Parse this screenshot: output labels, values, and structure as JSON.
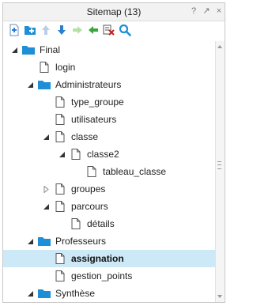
{
  "window": {
    "title": "Sitemap (13)",
    "controls": [
      "?",
      "↗",
      "×"
    ]
  },
  "toolbar": [
    {
      "name": "add-page-icon",
      "color": "#2a7fd0"
    },
    {
      "name": "add-folder-icon",
      "color": "#1e8fd6"
    },
    {
      "name": "move-up-icon",
      "color": "#b9cfe6"
    },
    {
      "name": "move-down-icon",
      "color": "#2a7fd0"
    },
    {
      "name": "indent-icon",
      "color": "#b6e0a6"
    },
    {
      "name": "outdent-icon",
      "color": "#3aa63a"
    },
    {
      "name": "delete-icon",
      "color": "#c02020"
    },
    {
      "name": "search-icon",
      "color": "#1e8fd6"
    }
  ],
  "tree": [
    {
      "label": "Final",
      "level": 0,
      "type": "folder",
      "expander": "expanded"
    },
    {
      "label": "login",
      "level": 1,
      "type": "page",
      "expander": "none"
    },
    {
      "label": "Administrateurs",
      "level": 1,
      "type": "folder",
      "expander": "expanded"
    },
    {
      "label": "type_groupe",
      "level": 2,
      "type": "page",
      "expander": "none"
    },
    {
      "label": "utilisateurs",
      "level": 2,
      "type": "page",
      "expander": "none"
    },
    {
      "label": "classe",
      "level": 2,
      "type": "page",
      "expander": "expanded"
    },
    {
      "label": "classe2",
      "level": 3,
      "type": "page",
      "expander": "expanded"
    },
    {
      "label": "tableau_classe",
      "level": 4,
      "type": "page",
      "expander": "none"
    },
    {
      "label": "groupes",
      "level": 2,
      "type": "page",
      "expander": "collapsed"
    },
    {
      "label": "parcours",
      "level": 2,
      "type": "page",
      "expander": "expanded"
    },
    {
      "label": "détails",
      "level": 3,
      "type": "page",
      "expander": "none"
    },
    {
      "label": "Professeurs",
      "level": 1,
      "type": "folder",
      "expander": "expanded"
    },
    {
      "label": "assignation",
      "level": 2,
      "type": "page",
      "expander": "none",
      "selected": true
    },
    {
      "label": "gestion_points",
      "level": 2,
      "type": "page",
      "expander": "none"
    },
    {
      "label": "Synthèse",
      "level": 1,
      "type": "folder",
      "expander": "expanded"
    }
  ],
  "colors": {
    "folder": "#1e8fd6",
    "selected_row": "#cde8f6"
  }
}
